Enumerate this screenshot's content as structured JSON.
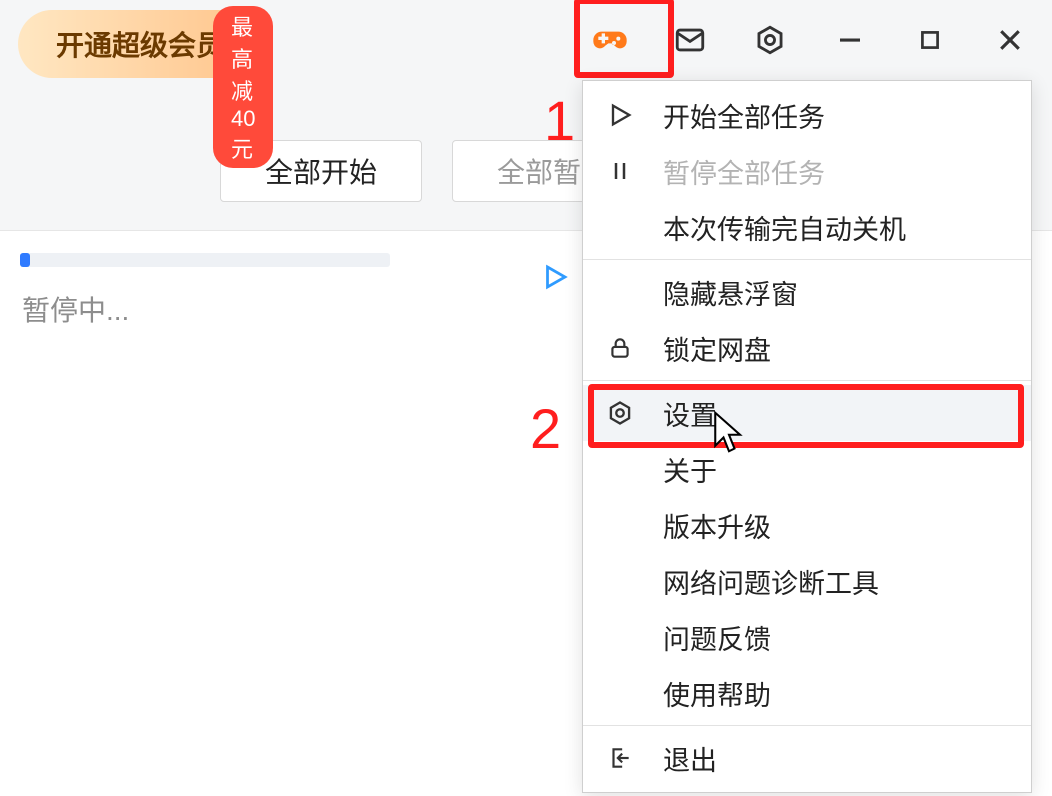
{
  "header": {
    "discount_label": "最高减40元",
    "vip_label": "开通超级会员"
  },
  "tabs": {
    "start_all": "全部开始",
    "pause_all": "全部暂停"
  },
  "transfer": {
    "status": "暂停中..."
  },
  "menu": {
    "start_all": "开始全部任务",
    "pause_all": "暂停全部任务",
    "auto_shutdown": "本次传输完自动关机",
    "hide_float": "隐藏悬浮窗",
    "lock_disk": "锁定网盘",
    "settings": "设置",
    "about": "关于",
    "upgrade": "版本升级",
    "net_diag": "网络问题诊断工具",
    "feedback": "问题反馈",
    "help": "使用帮助",
    "exit": "退出"
  },
  "annotations": {
    "one": "1",
    "two": "2"
  }
}
